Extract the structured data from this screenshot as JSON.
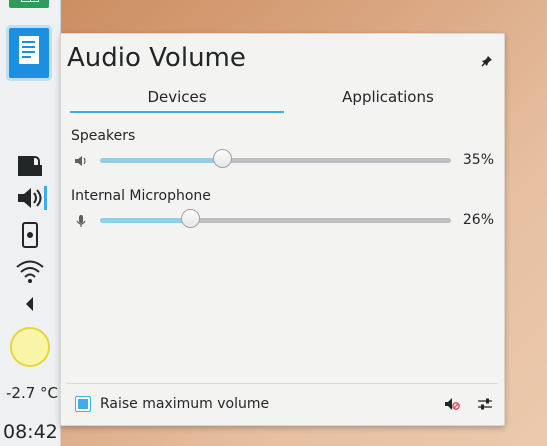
{
  "taskbar": {
    "launchers": [
      {
        "name": "spreadsheet-app",
        "icon": "spreadsheet-icon"
      },
      {
        "name": "document-app",
        "icon": "document-icon",
        "active": true
      }
    ],
    "tray": [
      "lock-icon",
      "speaker-icon",
      "phone-icon",
      "wifi-icon",
      "expand-arrow-icon"
    ],
    "weather_icon": "sun-icon",
    "temperature": "-2.7 °C",
    "clock": "08:42"
  },
  "popup": {
    "title": "Audio Volume",
    "pin_icon": "pin-icon",
    "tabs": [
      {
        "label": "Devices",
        "active": true
      },
      {
        "label": "Applications",
        "active": false
      }
    ],
    "devices": [
      {
        "name": "Speakers",
        "icon": "speaker-icon",
        "volume": 35,
        "volume_label": "35%"
      },
      {
        "name": "Internal Microphone",
        "icon": "microphone-icon",
        "volume": 26,
        "volume_label": "26%"
      }
    ],
    "raise_max_volume": {
      "label": "Raise maximum volume",
      "checked": true
    },
    "footer_icons": [
      "mute-speaker-icon",
      "settings-sliders-icon"
    ]
  },
  "colors": {
    "accent": "#3daee9",
    "slider_fill": "#93cee9",
    "text": "#232627"
  }
}
